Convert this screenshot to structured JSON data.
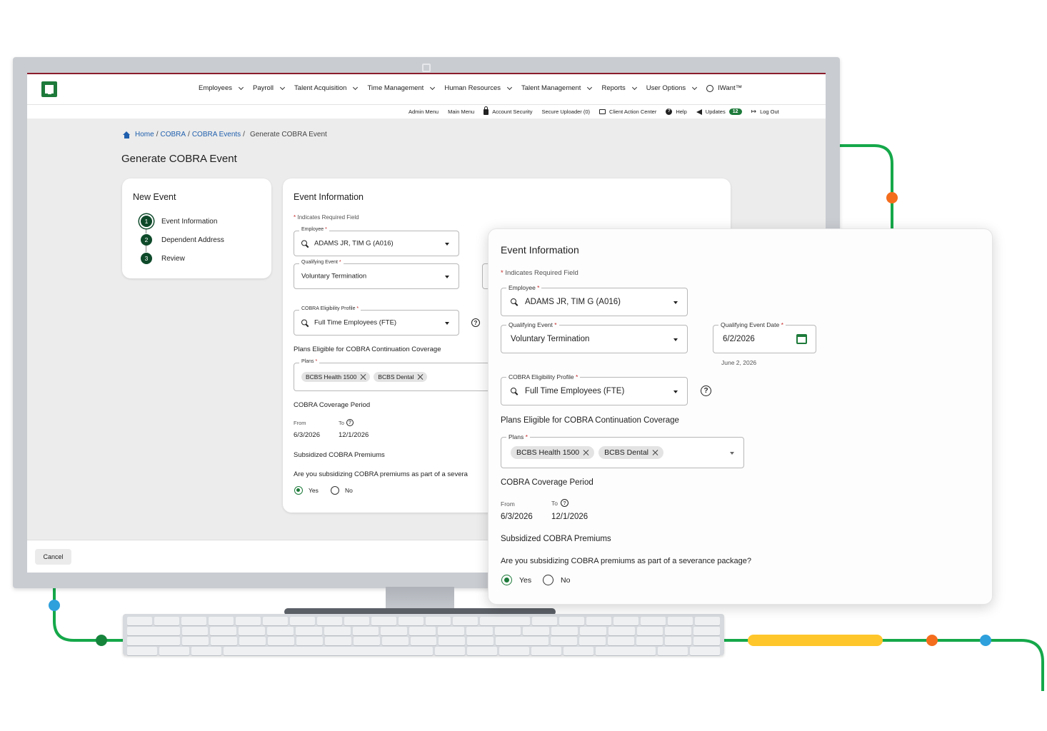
{
  "nav": {
    "main": [
      {
        "label": "Employees"
      },
      {
        "label": "Payroll"
      },
      {
        "label": "Talent Acquisition"
      },
      {
        "label": "Time Management"
      },
      {
        "label": "Human Resources"
      },
      {
        "label": "Talent Management"
      },
      {
        "label": "Reports"
      },
      {
        "label": "User Options"
      }
    ],
    "iwant": "IWant™",
    "sub": {
      "admin_menu": "Admin Menu",
      "main_menu": "Main Menu",
      "account_security": "Account Security",
      "secure_uploader": "Secure Uploader (0)",
      "client_action_center": "Client Action Center",
      "help": "Help",
      "updates": "Updates",
      "updates_count": "12",
      "log_out": "Log Out"
    }
  },
  "breadcrumb": {
    "home": "Home",
    "sep": "/",
    "cobra": "COBRA",
    "cobra_events": "COBRA Events",
    "current": "Generate COBRA Event"
  },
  "page_title": "Generate COBRA Event",
  "steps": {
    "title": "New Event",
    "items": [
      {
        "num": "1",
        "label": "Event Information"
      },
      {
        "num": "2",
        "label": "Dependent Address"
      },
      {
        "num": "3",
        "label": "Review"
      }
    ]
  },
  "form": {
    "title": "Event Information",
    "required_note": "Indicates Required Field",
    "employee": {
      "label": "Employee",
      "value": "ADAMS JR, TIM G (A016)"
    },
    "qualifying_event": {
      "label": "Qualifying Event",
      "value": "Voluntary Termination"
    },
    "qualifying_event_date": {
      "label": "Qualifying Event Date",
      "value": "6/2/2026",
      "helper": "June 2, 2026"
    },
    "eligibility_profile": {
      "label": "COBRA Eligibility Profile",
      "value": "Full Time Employees (FTE)"
    },
    "plans_section": "Plans Eligible for COBRA Continuation Coverage",
    "plans": {
      "label": "Plans",
      "chips": [
        "BCBS Health 1500",
        "BCBS Dental"
      ]
    },
    "coverage_section": "COBRA Coverage Period",
    "coverage": {
      "from_label": "From",
      "to_label": "To",
      "from": "6/3/2026",
      "to": "12/1/2026"
    },
    "subsidized_section": "Subsidized COBRA Premiums",
    "subsidized_question": "Are you subsidizing COBRA premiums as part of a severance package?",
    "subsidized_question_truncated": "Are you subsidizing COBRA premiums as part of a severa",
    "yes_label": "Yes",
    "no_label": "No",
    "selected": "Yes"
  },
  "footer": {
    "cancel": "Cancel"
  },
  "colors": {
    "brand_green": "#1d7a3a",
    "link_blue": "#1f5fad",
    "required_red": "#c62828",
    "dark_green": "#0e4a2a"
  }
}
